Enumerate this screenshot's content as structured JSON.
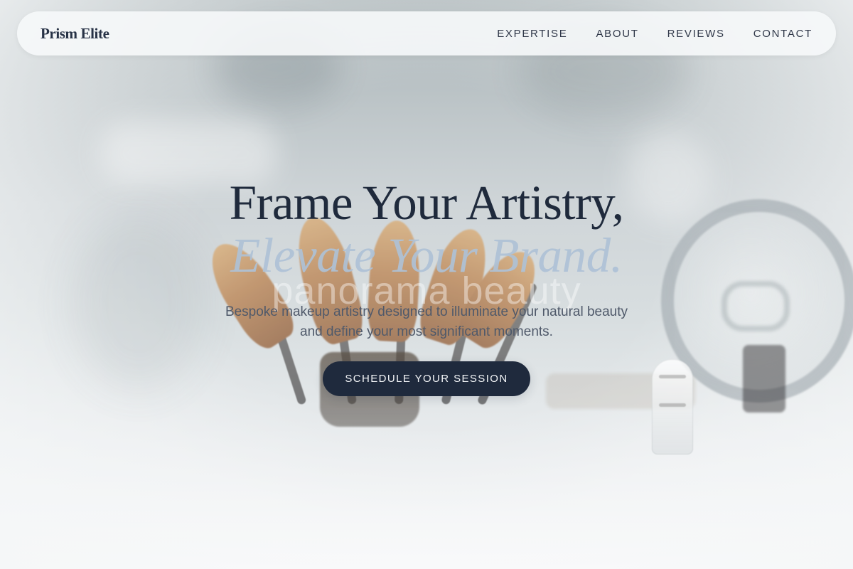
{
  "navigation": {
    "brand": "Prism Elite",
    "items": [
      {
        "label": "EXPERTISE"
      },
      {
        "label": "ABOUT"
      },
      {
        "label": "REVIEWS"
      },
      {
        "label": "CONTACT"
      }
    ]
  },
  "hero": {
    "title_line_1": "Frame Your Artistry,",
    "title_line_2": "Elevate Your Brand.",
    "watermark": "panorama beauty",
    "subtitle_line_1": "Bespoke makeup artistry designed to illuminate your natural beauty",
    "subtitle_line_2": "and define your most significant moments.",
    "cta_label": "SCHEDULE YOUR SESSION"
  },
  "colors": {
    "primary_text": "#1f2a3c",
    "accent_blue": "#aec1d6",
    "button_dark": "#1f2a3d",
    "nav_background": "#f6f8f9"
  },
  "icons": {
    "background_visual": "makeup-brushes-image"
  }
}
